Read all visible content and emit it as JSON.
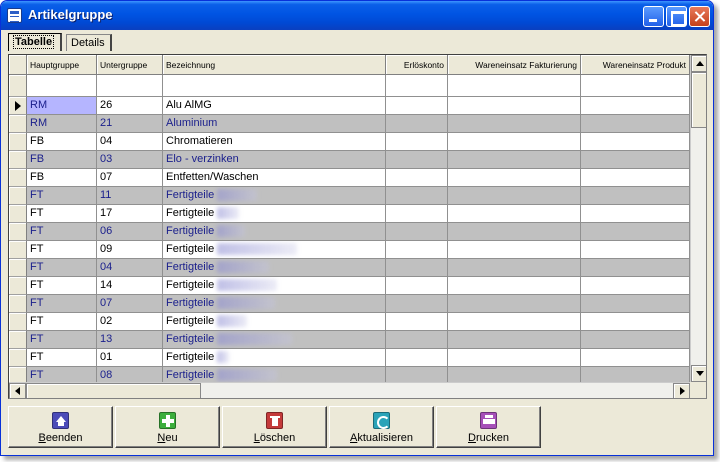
{
  "window": {
    "title": "Artikelgruppe"
  },
  "tabs": [
    {
      "label": "Tabelle",
      "active": true
    },
    {
      "label": "Details",
      "active": false
    }
  ],
  "columns": [
    {
      "label": "Hauptgruppe"
    },
    {
      "label": "Untergruppe"
    },
    {
      "label": "Bezeichnung"
    },
    {
      "label": "Erlöskonto"
    },
    {
      "label": "Wareneinsatz Fakturierung"
    },
    {
      "label": "Wareneinsatz Produkt"
    }
  ],
  "rows": [
    {
      "haupt": "RM",
      "unter": "26",
      "bez": "Alu AlMG",
      "current": true,
      "blurred": false
    },
    {
      "haupt": "RM",
      "unter": "21",
      "bez": "Aluminium",
      "blurred": false
    },
    {
      "haupt": "FB",
      "unter": "04",
      "bez": "Chromatieren",
      "blurred": false
    },
    {
      "haupt": "FB",
      "unter": "03",
      "bez": "Elo - verzinken",
      "blurred": false
    },
    {
      "haupt": "FB",
      "unter": "07",
      "bez": "Entfetten/Waschen",
      "blurred": false
    },
    {
      "haupt": "FT",
      "unter": "11",
      "bez": "Fertigteile",
      "blurred": true
    },
    {
      "haupt": "FT",
      "unter": "17",
      "bez": "Fertigteile",
      "blurred": true
    },
    {
      "haupt": "FT",
      "unter": "06",
      "bez": "Fertigteile",
      "blurred": true
    },
    {
      "haupt": "FT",
      "unter": "09",
      "bez": "Fertigteile",
      "blurred": true
    },
    {
      "haupt": "FT",
      "unter": "04",
      "bez": "Fertigteile",
      "blurred": true
    },
    {
      "haupt": "FT",
      "unter": "14",
      "bez": "Fertigteile",
      "blurred": true
    },
    {
      "haupt": "FT",
      "unter": "07",
      "bez": "Fertigteile",
      "blurred": true
    },
    {
      "haupt": "FT",
      "unter": "02",
      "bez": "Fertigteile",
      "blurred": true
    },
    {
      "haupt": "FT",
      "unter": "13",
      "bez": "Fertigteile",
      "blurred": true
    },
    {
      "haupt": "FT",
      "unter": "01",
      "bez": "Fertigteile",
      "blurred": true
    },
    {
      "haupt": "FT",
      "unter": "08",
      "bez": "Fertigteile",
      "blurred": true
    }
  ],
  "toolbar": {
    "buttons": [
      {
        "key": "beenden",
        "accel": "B",
        "rest": "eenden",
        "icon": "home-icon"
      },
      {
        "key": "neu",
        "accel": "N",
        "rest": "eu",
        "icon": "plus-icon"
      },
      {
        "key": "loeschen",
        "accel": "L",
        "rest": "öschen",
        "icon": "trash-icon"
      },
      {
        "key": "aktualisieren",
        "accel": "A",
        "rest": "ktualisieren",
        "icon": "refresh-icon"
      },
      {
        "key": "drucken",
        "accel": "D",
        "rest": "rucken",
        "icon": "print-icon"
      }
    ]
  },
  "colors": {
    "row_alt_bg": "#c0c0c0",
    "row_alt_text": "#1a1f8c",
    "selected_cell": "#b5b5ff",
    "titlebar": "#0054e3"
  }
}
